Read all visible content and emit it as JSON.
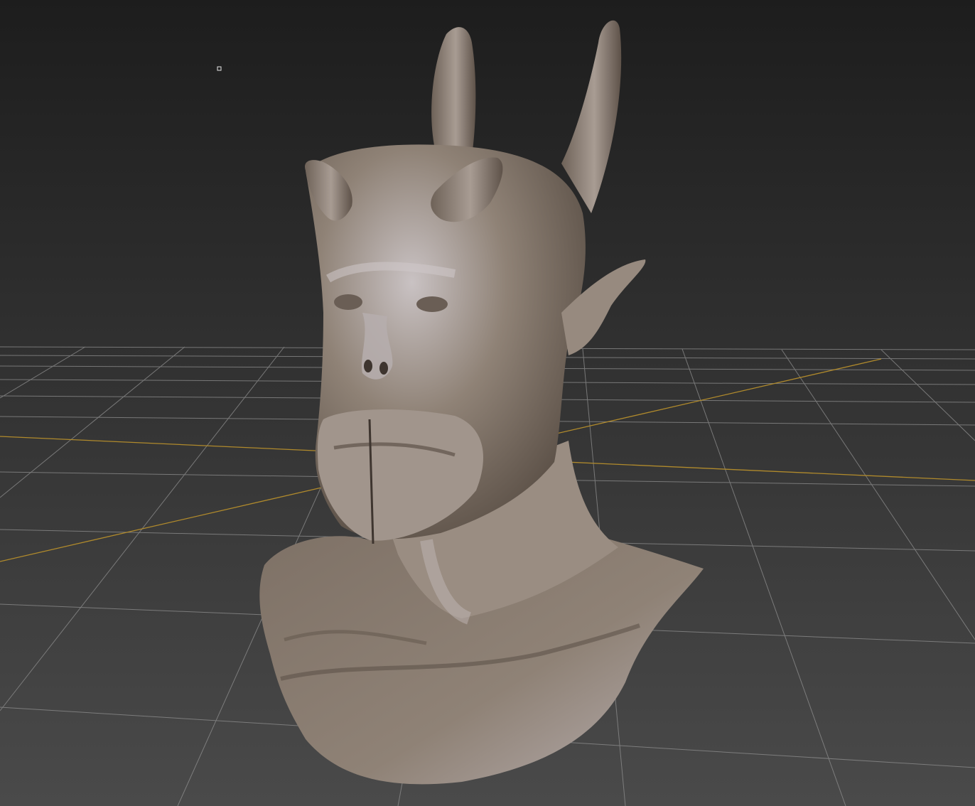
{
  "viewport": {
    "background_top": "#1d1d1d",
    "background_bottom": "#4a4a4a",
    "grid_color": "#8f8f8f",
    "axis_color": "#b08a2c",
    "model_color": "#8f8276",
    "model_highlight": "#c9c2c3",
    "model_shadow": "#554a41",
    "model_name": "horned-demon-bust"
  }
}
